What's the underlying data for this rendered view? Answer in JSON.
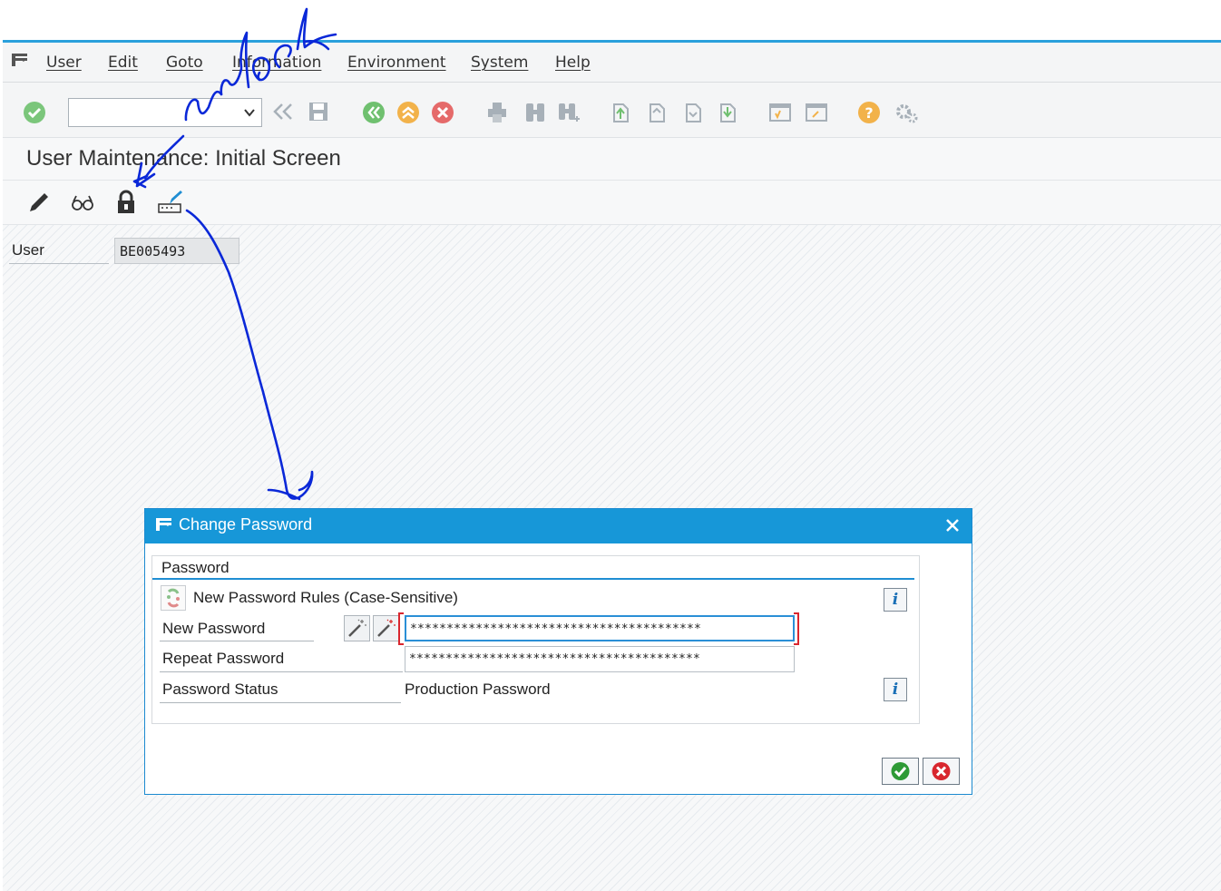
{
  "menu": {
    "items": [
      "User",
      "Edit",
      "Goto",
      "Information",
      "Environment",
      "System",
      "Help"
    ]
  },
  "toolbar": {
    "command_field_value": "",
    "icons": [
      "enter-icon",
      "back-icon",
      "save-icon",
      "back-green-icon",
      "exit-icon",
      "cancel-icon",
      "print-icon",
      "find-icon",
      "find-next-icon",
      "first-page-icon",
      "previous-page-icon",
      "next-page-icon",
      "last-page-icon",
      "create-session-icon",
      "shortcut-icon",
      "help-icon",
      "customize-icon"
    ]
  },
  "screen": {
    "title": "User Maintenance: Initial Screen",
    "app_toolbar_icons": [
      "change-icon",
      "display-icon",
      "lock-unlock-icon",
      "change-password-icon"
    ]
  },
  "user_field": {
    "label": "User",
    "value": "BE005493"
  },
  "dialog": {
    "title": "Change Password",
    "group_title": "Password",
    "rules_text": "New Password Rules (Case-Sensitive)",
    "new_password_label": "New Password",
    "new_password_value": "****************************************",
    "repeat_password_label": "Repeat Password",
    "repeat_password_value": "****************************************",
    "status_label": "Password Status",
    "status_value": "Production Password"
  },
  "annotation": {
    "handwritten_text": "unlock",
    "color": "#0a28d8"
  },
  "colors": {
    "accent": "#1797d8",
    "ok_green": "#3aa63a",
    "cancel_red": "#d8262e"
  }
}
